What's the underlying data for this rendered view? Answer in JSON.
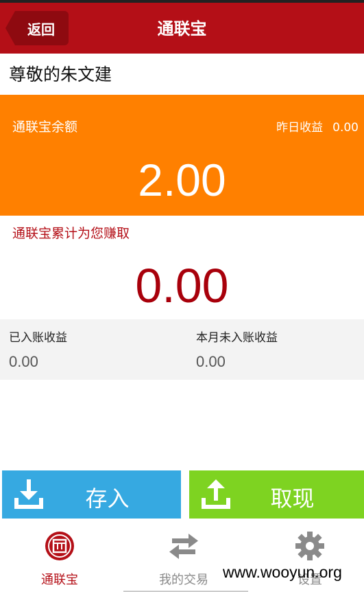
{
  "header": {
    "back_label": "返回",
    "title": "通联宝"
  },
  "greeting": "尊敬的朱文建",
  "balance": {
    "label": "通联宝余额",
    "yesterday_label": "昨日收益",
    "yesterday_value": "0.00",
    "amount": "2.00"
  },
  "cumulative": {
    "label": "通联宝累计为您赚取",
    "amount": "0.00"
  },
  "earnings": {
    "credited_label": "已入账收益",
    "credited_value": "0.00",
    "pending_label": "本月未入账收益",
    "pending_value": "0.00"
  },
  "actions": {
    "deposit_label": "存入",
    "withdraw_label": "取现"
  },
  "tabs": [
    {
      "label": "通联宝",
      "icon": "tonglianbao-icon",
      "active": true
    },
    {
      "label": "我的交易",
      "icon": "exchange-arrows-icon",
      "active": false
    },
    {
      "label": "设置",
      "icon": "gear-icon",
      "active": false
    }
  ],
  "watermark": "www.wooyun.org",
  "colors": {
    "header": "#b40f17",
    "balance_card": "#ff8000",
    "deposit": "#36a9e1",
    "withdraw": "#7ed321",
    "cumulative_text": "#a8000b"
  }
}
